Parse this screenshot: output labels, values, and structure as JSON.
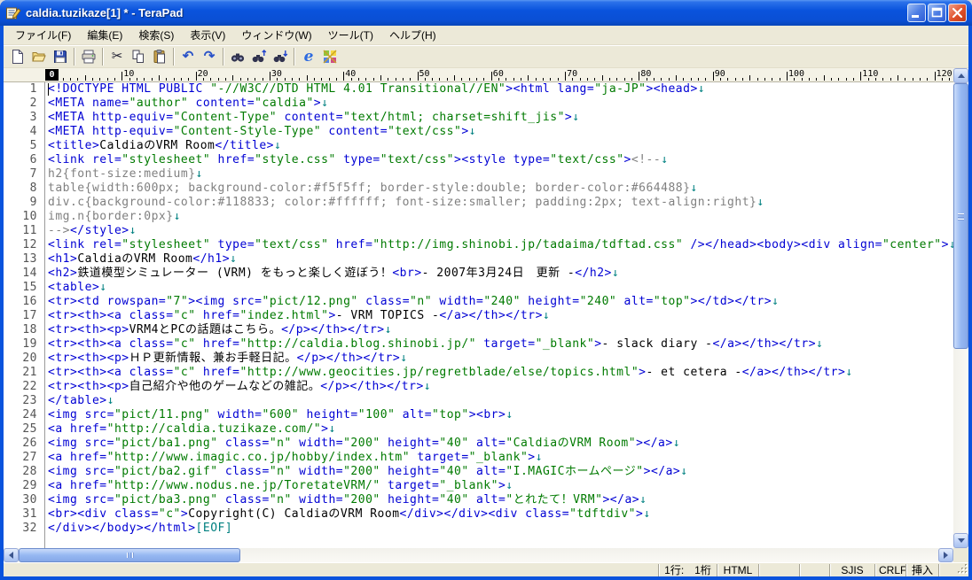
{
  "titlebar": {
    "title": "caldia.tuzikaze[1] * - TeraPad"
  },
  "window_controls": {
    "minimize": "minimize",
    "maximize": "maximize",
    "close": "close"
  },
  "menubar": {
    "items": [
      {
        "id": "file",
        "label": "ファイル(F)"
      },
      {
        "id": "edit",
        "label": "編集(E)"
      },
      {
        "id": "search",
        "label": "検索(S)"
      },
      {
        "id": "view",
        "label": "表示(V)"
      },
      {
        "id": "window",
        "label": "ウィンドウ(W)"
      },
      {
        "id": "tool",
        "label": "ツール(T)"
      },
      {
        "id": "help",
        "label": "ヘルプ(H)"
      }
    ]
  },
  "toolbar": {
    "groups": [
      [
        "new-file",
        "open-file",
        "save-file"
      ],
      [
        "print"
      ],
      [
        "cut",
        "copy",
        "paste"
      ],
      [
        "undo",
        "redo"
      ],
      [
        "find",
        "find-up",
        "find-down"
      ],
      [
        "ie-preview",
        "external-tool"
      ]
    ]
  },
  "ruler": {
    "marks": [
      0,
      10,
      20,
      30,
      40,
      50,
      60,
      70,
      80,
      90,
      100,
      110,
      120
    ],
    "caret_column_label": "0"
  },
  "editor": {
    "lines": [
      {
        "n": 1,
        "s": [
          [
            "t",
            "<!DOCTYPE HTML PUBLIC "
          ],
          [
            "v",
            "\"-//W3C//DTD HTML 4.01 Transitional//EN\""
          ],
          [
            "t",
            "><html lang="
          ],
          [
            "v",
            "\"ja-JP\""
          ],
          [
            "t",
            "><head>"
          ],
          [
            "n",
            "↓"
          ]
        ]
      },
      {
        "n": 2,
        "s": [
          [
            "t",
            "<META name="
          ],
          [
            "v",
            "\"author\""
          ],
          [
            "t",
            " content="
          ],
          [
            "v",
            "\"caldia\""
          ],
          [
            "t",
            ">"
          ],
          [
            "n",
            "↓"
          ]
        ]
      },
      {
        "n": 3,
        "s": [
          [
            "t",
            "<META http-equiv="
          ],
          [
            "v",
            "\"Content-Type\""
          ],
          [
            "t",
            " content="
          ],
          [
            "v",
            "\"text/html; charset=shift_jis\""
          ],
          [
            "t",
            ">"
          ],
          [
            "n",
            "↓"
          ]
        ]
      },
      {
        "n": 4,
        "s": [
          [
            "t",
            "<META http-equiv="
          ],
          [
            "v",
            "\"Content-Style-Type\""
          ],
          [
            "t",
            " content="
          ],
          [
            "v",
            "\"text/css\""
          ],
          [
            "t",
            ">"
          ],
          [
            "n",
            "↓"
          ]
        ]
      },
      {
        "n": 5,
        "s": [
          [
            "t",
            "<title>"
          ],
          [
            "x",
            "CaldiaのVRM Room"
          ],
          [
            "t",
            "</title>"
          ],
          [
            "n",
            "↓"
          ]
        ]
      },
      {
        "n": 6,
        "s": [
          [
            "t",
            "<link rel="
          ],
          [
            "v",
            "\"stylesheet\""
          ],
          [
            "t",
            " href="
          ],
          [
            "v",
            "\"style.css\""
          ],
          [
            "t",
            " type="
          ],
          [
            "v",
            "\"text/css\""
          ],
          [
            "t",
            "><style type="
          ],
          [
            "v",
            "\"text/css\""
          ],
          [
            "t",
            ">"
          ],
          [
            "c",
            "<!--"
          ],
          [
            "n",
            "↓"
          ]
        ]
      },
      {
        "n": 7,
        "s": [
          [
            "c",
            "h2{font-size:medium}"
          ],
          [
            "n",
            "↓"
          ]
        ]
      },
      {
        "n": 8,
        "s": [
          [
            "c",
            "table{width:600px; background-color:#f5f5ff; border-style:double; border-color:#664488}"
          ],
          [
            "n",
            "↓"
          ]
        ]
      },
      {
        "n": 9,
        "s": [
          [
            "c",
            "div.c{background-color:#118833; color:#ffffff; font-size:smaller; padding:2px; text-align:right}"
          ],
          [
            "n",
            "↓"
          ]
        ]
      },
      {
        "n": 10,
        "s": [
          [
            "c",
            "img.n{border:0px}"
          ],
          [
            "n",
            "↓"
          ]
        ]
      },
      {
        "n": 11,
        "s": [
          [
            "c",
            "-->"
          ],
          [
            "t",
            "</style>"
          ],
          [
            "n",
            "↓"
          ]
        ]
      },
      {
        "n": 12,
        "s": [
          [
            "t",
            "<link rel="
          ],
          [
            "v",
            "\"stylesheet\""
          ],
          [
            "t",
            " type="
          ],
          [
            "v",
            "\"text/css\""
          ],
          [
            "t",
            " href="
          ],
          [
            "v",
            "\"http://img.shinobi.jp/tadaima/tdftad.css\""
          ],
          [
            "t",
            " /></head><body><div align="
          ],
          [
            "v",
            "\"center\""
          ],
          [
            "t",
            ">"
          ],
          [
            "n",
            "↓"
          ]
        ]
      },
      {
        "n": 13,
        "s": [
          [
            "t",
            "<h1>"
          ],
          [
            "x",
            "CaldiaのVRM Room"
          ],
          [
            "t",
            "</h1>"
          ],
          [
            "n",
            "↓"
          ]
        ]
      },
      {
        "n": 14,
        "s": [
          [
            "t",
            "<h2>"
          ],
          [
            "x",
            "鉄道模型シミュレーター (VRM) をもっと楽しく遊ぼう！"
          ],
          [
            "t",
            "<br>"
          ],
          [
            "x",
            "- 2007年3月24日　更新 -"
          ],
          [
            "t",
            "</h2>"
          ],
          [
            "n",
            "↓"
          ]
        ]
      },
      {
        "n": 15,
        "s": [
          [
            "t",
            "<table>"
          ],
          [
            "n",
            "↓"
          ]
        ]
      },
      {
        "n": 16,
        "s": [
          [
            "t",
            "<tr><td rowspan="
          ],
          [
            "v",
            "\"7\""
          ],
          [
            "t",
            "><img src="
          ],
          [
            "v",
            "\"pict/12.png\""
          ],
          [
            "t",
            " class="
          ],
          [
            "v",
            "\"n\""
          ],
          [
            "t",
            " width="
          ],
          [
            "v",
            "\"240\""
          ],
          [
            "t",
            " height="
          ],
          [
            "v",
            "\"240\""
          ],
          [
            "t",
            " alt="
          ],
          [
            "v",
            "\"top\""
          ],
          [
            "t",
            "></td></tr>"
          ],
          [
            "n",
            "↓"
          ]
        ]
      },
      {
        "n": 17,
        "s": [
          [
            "t",
            "<tr><th><a class="
          ],
          [
            "v",
            "\"c\""
          ],
          [
            "t",
            " href="
          ],
          [
            "v",
            "\"indez.html\""
          ],
          [
            "t",
            ">"
          ],
          [
            "x",
            "- VRM TOPICS -"
          ],
          [
            "t",
            "</a></th></tr>"
          ],
          [
            "n",
            "↓"
          ]
        ]
      },
      {
        "n": 18,
        "s": [
          [
            "t",
            "<tr><th><p>"
          ],
          [
            "x",
            "VRM4とPCの話題はこちら。"
          ],
          [
            "t",
            "</p></th></tr>"
          ],
          [
            "n",
            "↓"
          ]
        ]
      },
      {
        "n": 19,
        "s": [
          [
            "t",
            "<tr><th><a class="
          ],
          [
            "v",
            "\"c\""
          ],
          [
            "t",
            " href="
          ],
          [
            "v",
            "\"http://caldia.blog.shinobi.jp/\""
          ],
          [
            "t",
            " target="
          ],
          [
            "v",
            "\"_blank\""
          ],
          [
            "t",
            ">"
          ],
          [
            "x",
            "- slack diary -"
          ],
          [
            "t",
            "</a></th></tr>"
          ],
          [
            "n",
            "↓"
          ]
        ]
      },
      {
        "n": 20,
        "s": [
          [
            "t",
            "<tr><th><p>"
          ],
          [
            "x",
            "ＨＰ更新情報、兼お手軽日記。"
          ],
          [
            "t",
            "</p></th></tr>"
          ],
          [
            "n",
            "↓"
          ]
        ]
      },
      {
        "n": 21,
        "s": [
          [
            "t",
            "<tr><th><a class="
          ],
          [
            "v",
            "\"c\""
          ],
          [
            "t",
            " href="
          ],
          [
            "v",
            "\"http://www.geocities.jp/regretblade/else/topics.html\""
          ],
          [
            "t",
            ">"
          ],
          [
            "x",
            "- et cetera -"
          ],
          [
            "t",
            "</a></th></tr>"
          ],
          [
            "n",
            "↓"
          ]
        ]
      },
      {
        "n": 22,
        "s": [
          [
            "t",
            "<tr><th><p>"
          ],
          [
            "x",
            "自己紹介や他のゲームなどの雑記。"
          ],
          [
            "t",
            "</p></th></tr>"
          ],
          [
            "n",
            "↓"
          ]
        ]
      },
      {
        "n": 23,
        "s": [
          [
            "t",
            "</table>"
          ],
          [
            "n",
            "↓"
          ]
        ]
      },
      {
        "n": 24,
        "s": [
          [
            "t",
            "<img src="
          ],
          [
            "v",
            "\"pict/11.png\""
          ],
          [
            "t",
            " width="
          ],
          [
            "v",
            "\"600\""
          ],
          [
            "t",
            " height="
          ],
          [
            "v",
            "\"100\""
          ],
          [
            "t",
            " alt="
          ],
          [
            "v",
            "\"top\""
          ],
          [
            "t",
            "><br>"
          ],
          [
            "n",
            "↓"
          ]
        ]
      },
      {
        "n": 25,
        "s": [
          [
            "t",
            "<a href="
          ],
          [
            "v",
            "\"http://caldia.tuzikaze.com/\""
          ],
          [
            "t",
            ">"
          ],
          [
            "n",
            "↓"
          ]
        ]
      },
      {
        "n": 26,
        "s": [
          [
            "t",
            "<img src="
          ],
          [
            "v",
            "\"pict/ba1.png\""
          ],
          [
            "t",
            " class="
          ],
          [
            "v",
            "\"n\""
          ],
          [
            "t",
            " width="
          ],
          [
            "v",
            "\"200\""
          ],
          [
            "t",
            " height="
          ],
          [
            "v",
            "\"40\""
          ],
          [
            "t",
            " alt="
          ],
          [
            "v",
            "\"CaldiaのVRM Room\""
          ],
          [
            "t",
            "></a>"
          ],
          [
            "n",
            "↓"
          ]
        ]
      },
      {
        "n": 27,
        "s": [
          [
            "t",
            "<a href="
          ],
          [
            "v",
            "\"http://www.imagic.co.jp/hobby/index.htm\""
          ],
          [
            "t",
            " target="
          ],
          [
            "v",
            "\"_blank\""
          ],
          [
            "t",
            ">"
          ],
          [
            "n",
            "↓"
          ]
        ]
      },
      {
        "n": 28,
        "s": [
          [
            "t",
            "<img src="
          ],
          [
            "v",
            "\"pict/ba2.gif\""
          ],
          [
            "t",
            " class="
          ],
          [
            "v",
            "\"n\""
          ],
          [
            "t",
            " width="
          ],
          [
            "v",
            "\"200\""
          ],
          [
            "t",
            " height="
          ],
          [
            "v",
            "\"40\""
          ],
          [
            "t",
            " alt="
          ],
          [
            "v",
            "\"I.MAGICホームページ\""
          ],
          [
            "t",
            "></a>"
          ],
          [
            "n",
            "↓"
          ]
        ]
      },
      {
        "n": 29,
        "s": [
          [
            "t",
            "<a href="
          ],
          [
            "v",
            "\"http://www.nodus.ne.jp/ToretateVRM/\""
          ],
          [
            "t",
            " target="
          ],
          [
            "v",
            "\"_blank\""
          ],
          [
            "t",
            ">"
          ],
          [
            "n",
            "↓"
          ]
        ]
      },
      {
        "n": 30,
        "s": [
          [
            "t",
            "<img src="
          ],
          [
            "v",
            "\"pict/ba3.png\""
          ],
          [
            "t",
            " class="
          ],
          [
            "v",
            "\"n\""
          ],
          [
            "t",
            " width="
          ],
          [
            "v",
            "\"200\""
          ],
          [
            "t",
            " height="
          ],
          [
            "v",
            "\"40\""
          ],
          [
            "t",
            " alt="
          ],
          [
            "v",
            "\"とれたて！VRM\""
          ],
          [
            "t",
            "></a>"
          ],
          [
            "n",
            "↓"
          ]
        ]
      },
      {
        "n": 31,
        "s": [
          [
            "t",
            "<br><div class="
          ],
          [
            "v",
            "\"c\""
          ],
          [
            "t",
            ">"
          ],
          [
            "x",
            "Copyright(C) CaldiaのVRM Room"
          ],
          [
            "t",
            "</div></div><div class="
          ],
          [
            "v",
            "\"tdftdiv\""
          ],
          [
            "t",
            ">"
          ],
          [
            "n",
            "↓"
          ]
        ]
      },
      {
        "n": 32,
        "s": [
          [
            "t",
            "</div></body></html>"
          ],
          [
            "e",
            "[EOF]"
          ]
        ]
      }
    ]
  },
  "statusbar": {
    "fields": [
      "1行:　1桁",
      "HTML",
      "",
      "",
      "SJIS",
      "CRLF",
      "挿入"
    ]
  },
  "colors": {
    "tag": "#0000D4",
    "attribute_value": "#007A00",
    "plain_text": "#000000",
    "comment": "#808080",
    "linebreak_mark": "#008080",
    "eof_mark": "#008080",
    "titlebar_blue": "#0A53DD",
    "chrome": "#ECE9D8"
  }
}
